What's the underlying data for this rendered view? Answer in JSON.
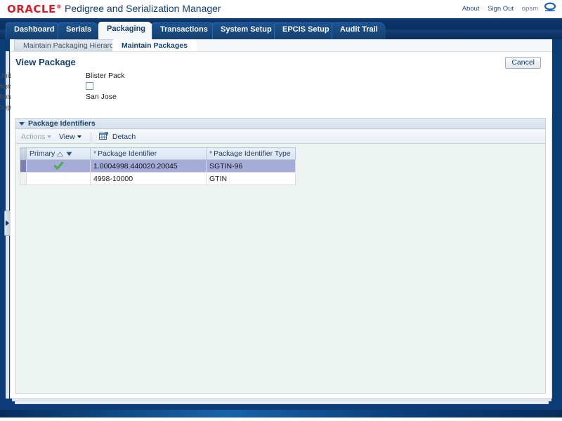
{
  "branding": {
    "logo_text": "ORACLE",
    "logo_mark": "oracle-circle-mark",
    "app_title": "Pedigree and Serialization Manager",
    "links": [
      {
        "label": "About",
        "name": "about-link"
      },
      {
        "label": "Sign Out",
        "name": "sign-out-link"
      }
    ],
    "user": "opsm"
  },
  "tabs": [
    {
      "label": "Dashboard",
      "active": false
    },
    {
      "label": "Serials",
      "active": false
    },
    {
      "label": "Packaging",
      "active": true
    },
    {
      "label": "Transactions",
      "active": false
    },
    {
      "label": "System Setup",
      "active": false
    },
    {
      "label": "EPCIS Setup",
      "active": false
    },
    {
      "label": "Audit Trail",
      "active": false
    }
  ],
  "subtabs": [
    {
      "label": "Maintain Packaging Hierarchy",
      "active": false
    },
    {
      "label": "Maintain Packages",
      "active": true
    }
  ],
  "page": {
    "title": "View Package",
    "cancel_label": "Cancel",
    "fields": [
      {
        "label": "Packaging Unit",
        "value": "Blister Pack",
        "type": "text",
        "name": "packaging-unit"
      },
      {
        "label": "Reusable Package",
        "value": "",
        "type": "checkbox",
        "checked": false,
        "name": "reusable-package"
      },
      {
        "label": "Location",
        "value": "San Jose",
        "type": "text",
        "name": "location"
      },
      {
        "label": "Location Group",
        "value": "",
        "type": "text",
        "name": "location-group"
      }
    ]
  },
  "region": {
    "title": "Package Identifiers",
    "toolbar": {
      "actions_label": "Actions",
      "view_label": "View",
      "detach_label": "Detach"
    },
    "table": {
      "columns": [
        {
          "label": "Primary",
          "required": false,
          "sortable": true
        },
        {
          "label": "Package Identifier",
          "required": true,
          "sortable": false
        },
        {
          "label": "Package Identifier Type",
          "required": true,
          "sortable": false
        }
      ],
      "rows": [
        {
          "primary": true,
          "identifier": "1.0004998.440020.20045",
          "identifier_type": "SGTIN-96",
          "selected": true
        },
        {
          "primary": false,
          "identifier": "4998-10000",
          "identifier_type": "GTIN",
          "selected": false
        }
      ]
    }
  },
  "colors": {
    "oracle_red": "#d4202c",
    "header_blue": "#103d73",
    "tab_strip": "#0a2f5e",
    "selection": "#a4acd8",
    "check_green": "#3aa52a",
    "label_text": "#5a5140"
  }
}
